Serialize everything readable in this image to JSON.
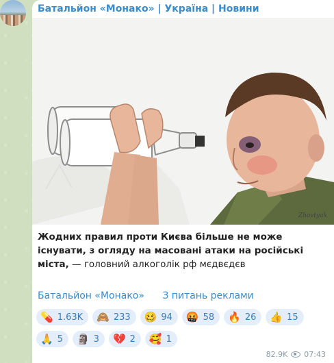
{
  "channel": {
    "name": "Батальйон «Монако» | Україна | Новини"
  },
  "post": {
    "caption_bold": "Жодних правил проти Києва більше не може існувати, з огляду на масовані атаки на російські міста,",
    "caption_rest": " — головний алкоголік рф мєдвєдєв",
    "links": [
      "Батальйон «Монако»",
      "З питань реклами"
    ],
    "reactions_row1": [
      {
        "icon": "pill-icon",
        "emoji": "💊",
        "count": "1.63K"
      },
      {
        "icon": "monkey-icon",
        "emoji": "🙈",
        "count": "233"
      },
      {
        "icon": "woozy-face-icon",
        "emoji": "🥴",
        "count": "94"
      },
      {
        "icon": "cursing-face-icon",
        "emoji": "🤬",
        "count": "58"
      },
      {
        "icon": "fire-icon",
        "emoji": "🔥",
        "count": "26"
      },
      {
        "icon": "thumbs-up-icon",
        "emoji": "👍",
        "count": "15"
      }
    ],
    "reactions_row2": [
      {
        "icon": "praying-hands-icon",
        "emoji": "🙏",
        "count": "5"
      },
      {
        "icon": "moai-icon",
        "emoji": "🗿",
        "count": "3"
      },
      {
        "icon": "broken-heart-icon",
        "emoji": "💔",
        "count": "2"
      },
      {
        "icon": "smiling-hearts-icon",
        "emoji": "🥰",
        "count": "1"
      }
    ],
    "views": "82.9K",
    "time": "07:43"
  },
  "colors": {
    "accent": "#3a8ccb",
    "reaction_bg": "#e4eefb",
    "chat_bg": "#cfdfbf"
  }
}
